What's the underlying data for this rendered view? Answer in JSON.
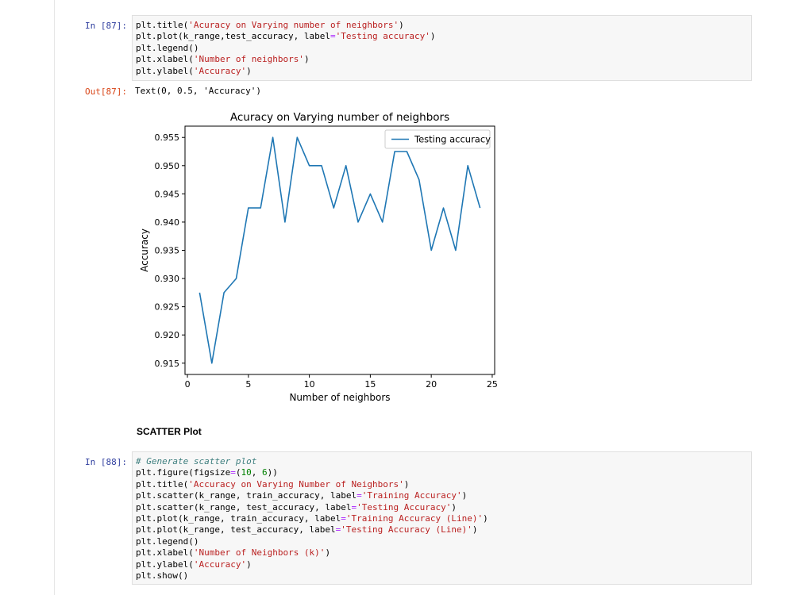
{
  "cell87": {
    "prompt_in": "In [87]:",
    "prompt_out": "Out[87]:",
    "output_text": "Text(0, 0.5, 'Accuracy')",
    "code": [
      [
        [
          "plt.title(",
          ""
        ],
        [
          "'Acuracy on Varying number of neighbors'",
          "s"
        ],
        [
          ")",
          ""
        ]
      ],
      [
        [
          "plt.plot(k_range,test_accuracy, label",
          ""
        ],
        [
          "=",
          "o"
        ],
        [
          "'Testing accuracy'",
          "s"
        ],
        [
          ")",
          ""
        ]
      ],
      [
        [
          "plt.legend()",
          ""
        ]
      ],
      [
        [
          "plt.xlabel(",
          ""
        ],
        [
          "'Number of neighbors'",
          "s"
        ],
        [
          ")",
          ""
        ]
      ],
      [
        [
          "plt.ylabel(",
          ""
        ],
        [
          "'Accuracy'",
          "s"
        ],
        [
          ")",
          ""
        ]
      ]
    ]
  },
  "chart_data": {
    "type": "line",
    "title": "Acuracy on Varying number of neighbors",
    "xlabel": "Number of neighbors",
    "ylabel": "Accuracy",
    "xlim": [
      -0.2,
      25.2
    ],
    "ylim": [
      0.913,
      0.957
    ],
    "xticks": [
      0,
      5,
      10,
      15,
      20,
      25
    ],
    "yticks": [
      "0.915",
      "0.920",
      "0.925",
      "0.930",
      "0.935",
      "0.940",
      "0.945",
      "0.950",
      "0.955"
    ],
    "legend_position": "top-right",
    "grid": false,
    "series": [
      {
        "name": "Testing accuracy",
        "color": "#1f77b4",
        "x": [
          1,
          2,
          3,
          4,
          5,
          6,
          7,
          8,
          9,
          10,
          11,
          12,
          13,
          14,
          15,
          16,
          17,
          18,
          19,
          20,
          21,
          22,
          23,
          24
        ],
        "y": [
          0.9275,
          0.915,
          0.9275,
          0.93,
          0.9425,
          0.9425,
          0.955,
          0.94,
          0.955,
          0.95,
          0.95,
          0.9425,
          0.95,
          0.94,
          0.945,
          0.94,
          0.9525,
          0.9525,
          0.9475,
          0.935,
          0.9425,
          0.935,
          0.95,
          0.9425
        ]
      }
    ]
  },
  "markdown": {
    "heading": "SCATTER Plot"
  },
  "cell88": {
    "prompt_in": "In [88]:",
    "code": [
      [
        [
          "# Generate scatter plot",
          "c"
        ]
      ],
      [
        [
          "plt.figure(figsize",
          ""
        ],
        [
          "=",
          "o"
        ],
        [
          "(",
          ""
        ],
        [
          "10",
          "n"
        ],
        [
          ", ",
          ""
        ],
        [
          "6",
          "n"
        ],
        [
          "))",
          ""
        ]
      ],
      [
        [
          "plt.title(",
          ""
        ],
        [
          "'Accuracy on Varying Number of Neighbors'",
          "s"
        ],
        [
          ")",
          ""
        ]
      ],
      [
        [
          "plt.scatter(k_range, train_accuracy, label",
          ""
        ],
        [
          "=",
          "o"
        ],
        [
          "'Training Accuracy'",
          "s"
        ],
        [
          ")",
          ""
        ]
      ],
      [
        [
          "plt.scatter(k_range, test_accuracy, label",
          ""
        ],
        [
          "=",
          "o"
        ],
        [
          "'Testing Accuracy'",
          "s"
        ],
        [
          ")",
          ""
        ]
      ],
      [
        [
          "plt.plot(k_range, train_accuracy, label",
          ""
        ],
        [
          "=",
          "o"
        ],
        [
          "'Training Accuracy (Line)'",
          "s"
        ],
        [
          ")",
          ""
        ]
      ],
      [
        [
          "plt.plot(k_range, test_accuracy, label",
          ""
        ],
        [
          "=",
          "o"
        ],
        [
          "'Testing Accuracy (Line)'",
          "s"
        ],
        [
          ")",
          ""
        ]
      ],
      [
        [
          "plt.legend()",
          ""
        ]
      ],
      [
        [
          "plt.xlabel(",
          ""
        ],
        [
          "'Number of Neighbors (k)'",
          "s"
        ],
        [
          ")",
          ""
        ]
      ],
      [
        [
          "plt.ylabel(",
          ""
        ],
        [
          "'Accuracy'",
          "s"
        ],
        [
          ")",
          ""
        ]
      ],
      [
        [
          "plt.show()",
          ""
        ]
      ]
    ]
  }
}
